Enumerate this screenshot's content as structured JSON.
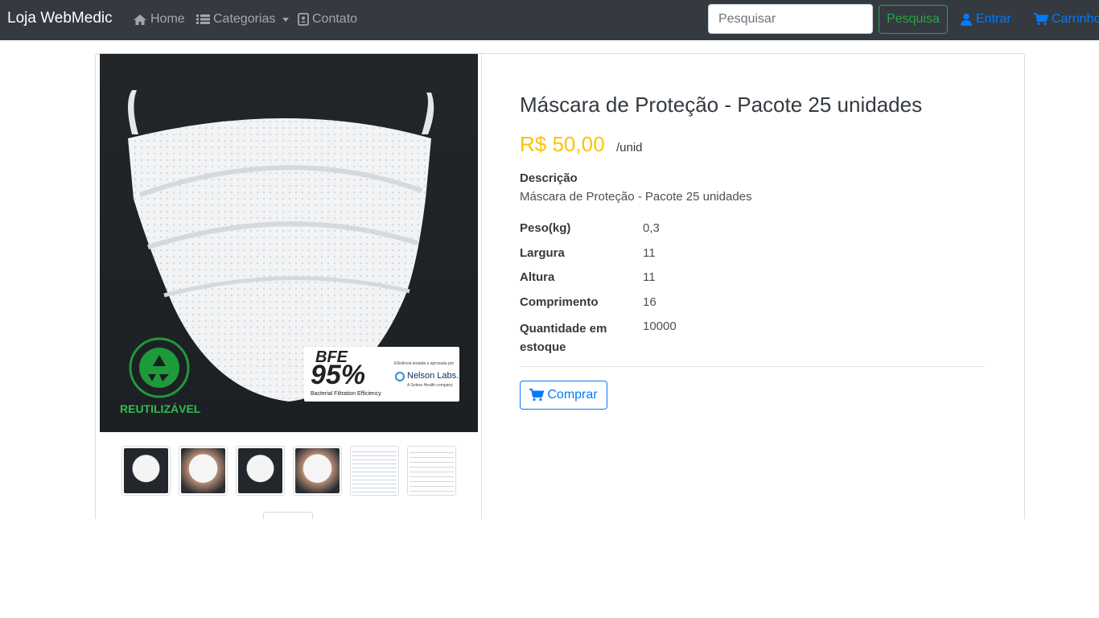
{
  "navbar": {
    "brand": "Loja WebMedic",
    "links": [
      {
        "label": "Home",
        "icon": "home-icon"
      },
      {
        "label": "Categorias",
        "icon": "list-icon"
      },
      {
        "label": "Contato",
        "icon": "contact-card-icon"
      }
    ],
    "search": {
      "placeholder": "Pesquisar",
      "value": ""
    },
    "search_button": "Pesquisa",
    "login_label": "Entrar",
    "cart_label": "Carrinho",
    "colors": {
      "background": "#343a40",
      "accent_green": "#28a745",
      "accent_blue": "#007bff"
    }
  },
  "product": {
    "image": {
      "badge_recycle": "REUTILIZÁVEL",
      "bfe_label": "BFE",
      "bfe_percent": "95%",
      "bfe_caption": "Bacterial Filtration Efficiency",
      "lab_note": "Eficiência testada e aprovada por",
      "lab_name": "Nelson Labs.",
      "lab_sub": "A Sotera Health company"
    },
    "thumbnails": [
      "thumb-mask-dark",
      "thumb-mask-face",
      "thumb-mask-side",
      "thumb-mask-worn",
      "thumb-document-blue",
      "thumb-document-report"
    ],
    "title": "Máscara de Proteção - Pacote 25 unidades",
    "price": "R$ 50,00",
    "price_unit": "/unid",
    "price_color": "#ffc107",
    "description_label": "Descrição",
    "description": "Máscara de Proteção - Pacote 25 unidades",
    "specs": [
      {
        "label": "Peso(kg)",
        "value": "0,3"
      },
      {
        "label": "Largura",
        "value": "11"
      },
      {
        "label": "Altura",
        "value": "11"
      },
      {
        "label": "Comprimento",
        "value": "16"
      },
      {
        "label": "Quantidade em estoque",
        "value": "10000"
      }
    ],
    "buy_button": "Comprar"
  }
}
